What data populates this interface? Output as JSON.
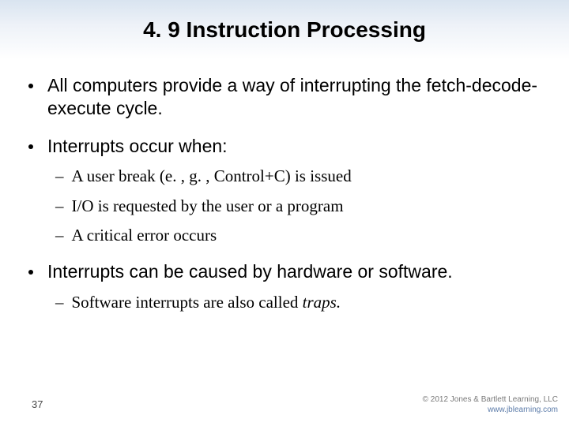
{
  "title": "4. 9 Instruction Processing",
  "bullets": [
    {
      "level": 1,
      "text": "All computers provide a way of interrupting the fetch-decode-execute cycle."
    },
    {
      "level": 1,
      "text": "Interrupts occur when:"
    },
    {
      "level": 2,
      "text": "A user break (e. , g. , Control+C) is issued"
    },
    {
      "level": 2,
      "text": "I/O is requested by the user or a program"
    },
    {
      "level": 2,
      "text": "A critical error occurs"
    },
    {
      "level": 1,
      "text": "Interrupts can be caused by hardware or software."
    },
    {
      "level": 2,
      "text_prefix": "Software interrupts are also called ",
      "text_italic": "traps.",
      "text_suffix": ""
    }
  ],
  "page_number": "37",
  "copyright": {
    "line1": "© 2012 Jones & Bartlett Learning, LLC",
    "line2": "www.jblearning.com"
  }
}
